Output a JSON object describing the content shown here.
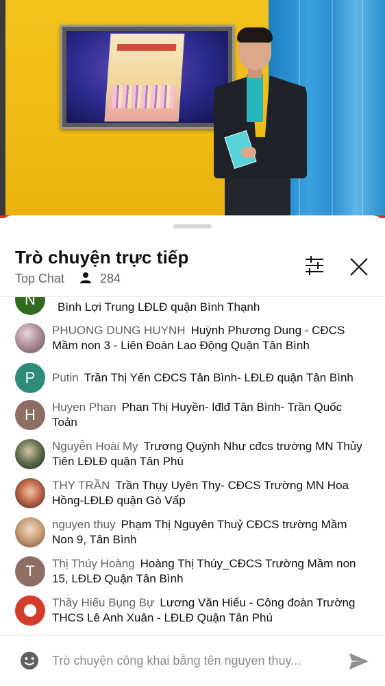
{
  "chat": {
    "title": "Trò chuyện trực tiếp",
    "mode_label": "Top Chat",
    "viewer_count": "284",
    "input_placeholder": "Trò chuyện công khai bằng tên nguyen thuy...",
    "messages": [
      {
        "author": "",
        "initial": "N",
        "avatar_color": "#33691e",
        "text": "Bình Lợi Trung LĐLĐ quận Bình Thạnh"
      },
      {
        "author": "PHUONG DUNG HUYNH",
        "text": "Huỳnh Phương Dung - CĐCS Mầm non 3 - Liên Đoàn Lao Động Quận Tân Bình"
      },
      {
        "author": "Putin",
        "initial": "P",
        "avatar_color": "#2e8b7a",
        "text": "Trần Thị Yến CĐCS Tân Bình- LĐLĐ quận Tân Bình"
      },
      {
        "author": "Huyen Phan",
        "initial": "H",
        "avatar_color": "#8d6e63",
        "text": "Phan Thị Huyền- lđlđ Tân Bình- Trần Quốc Toản"
      },
      {
        "author": "Nguyễn Hoài My",
        "text": "Trương Quỳnh Như cđcs trường MN Thủy Tiên LĐLĐ quận Tân Phú"
      },
      {
        "author": "THY TRẦN",
        "text": "Trần Thụy Uyên Thy- CĐCS Trường MN Hoa Hồng-LĐLĐ quận Gò Vấp"
      },
      {
        "author": "nguyen thuy",
        "text": "Phạm Thị Nguyên Thuỷ CĐCS trường Mầm Non 9, Tân Bình"
      },
      {
        "author": "Thị Thúy Hoàng",
        "initial": "T",
        "avatar_color": "#8d6e63",
        "text": "Hoàng Thị Thúy_CĐCS Trường Mầm non 15, LĐLĐ Quận Tân Bình"
      },
      {
        "author": "Thầy Hiếu Bụng Bự",
        "text": "Lương Văn Hiếu - Công đoàn Trường THCS Lê Anh Xuân - LĐLĐ Quận Tân Phú"
      }
    ]
  },
  "icons": {
    "viewers": "person-icon",
    "filter": "sliders-icon",
    "close": "close-icon",
    "emoji": "emoji-icon",
    "send": "send-icon"
  },
  "colors": {
    "title": "#0f0f0f",
    "secondary_text": "#606060",
    "divider": "#e5e5e5",
    "icon": "#606060"
  }
}
